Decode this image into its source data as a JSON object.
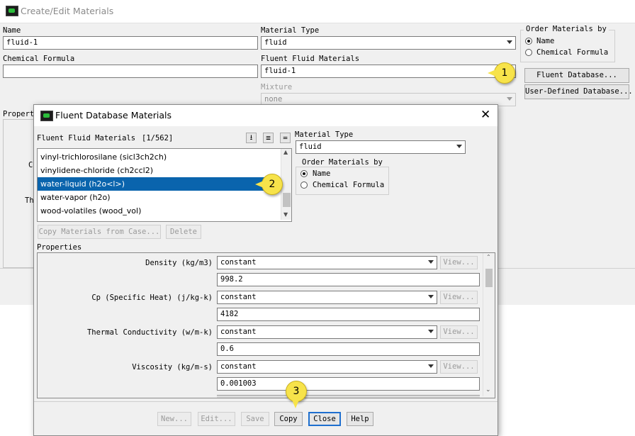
{
  "main": {
    "title": "Create/Edit Materials",
    "name_label": "Name",
    "name_value": "fluid-1",
    "chem_label": "Chemical Formula",
    "chem_value": "",
    "material_type_label": "Material Type",
    "material_type_value": "fluid",
    "fluent_fluid_label": "Fluent Fluid Materials",
    "fluent_fluid_value": "fluid-1",
    "mixture_label": "Mixture",
    "mixture_value": "none",
    "order_title": "Order Materials by",
    "order_name": "Name",
    "order_chem": "Chemical Formula",
    "fluent_db_button": "Fluent Database...",
    "user_db_button": "User-Defined Database...",
    "properties_label_partial": "Propert",
    "partial_c": "C",
    "partial_th": "Th"
  },
  "dialog": {
    "title": "Fluent Database Materials",
    "list_label": "Fluent Fluid Materials",
    "list_count": "[1/562]",
    "sort_icons": [
      "sort-icon",
      "list-icon",
      "equals-icon"
    ],
    "materials": [
      {
        "label": "vinyl-trichlorosilane (sicl3ch2ch)",
        "selected": false
      },
      {
        "label": "vinylidene-chloride (ch2ccl2)",
        "selected": false
      },
      {
        "label": "water-liquid (h2o<l>)",
        "selected": true
      },
      {
        "label": "water-vapor (h2o)",
        "selected": false
      },
      {
        "label": "wood-volatiles (wood_vol)",
        "selected": false
      }
    ],
    "material_type_label": "Material Type",
    "material_type_value": "fluid",
    "order_title": "Order Materials by",
    "order_name": "Name",
    "order_chem": "Chemical Formula",
    "copy_from_case": "Copy Materials from Case...",
    "delete": "Delete",
    "properties_label": "Properties",
    "properties": [
      {
        "label": "Density (kg/m3)",
        "method": "constant",
        "view": "View...",
        "value": "998.2"
      },
      {
        "label": "Cp (Specific Heat) (j/kg-k)",
        "method": "constant",
        "view": "View...",
        "value": "4182"
      },
      {
        "label": "Thermal Conductivity (w/m-k)",
        "method": "constant",
        "view": "View...",
        "value": "0.6"
      },
      {
        "label": "Viscosity (kg/m-s)",
        "method": "constant",
        "view": "View...",
        "value": "0.001003"
      }
    ],
    "buttons": {
      "new": "New...",
      "edit": "Edit...",
      "save": "Save",
      "copy": "Copy",
      "close": "Close",
      "help": "Help"
    }
  },
  "callouts": [
    "1",
    "2",
    "3"
  ],
  "colors": {
    "selection": "#0a64ad",
    "callout": "#f7e34a",
    "dialog_bg": "#f0f0f0",
    "focus": "#1e6fcf"
  }
}
